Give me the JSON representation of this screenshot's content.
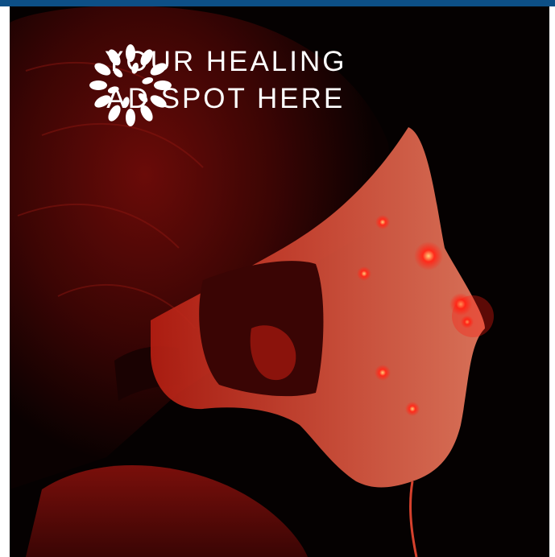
{
  "ad": {
    "headline_line1": "YOUR HEALING",
    "headline_line2": "AD SPOT HERE",
    "logo_icon": "leaf-burst-logo-icon",
    "photo_subject": "person-wearing-red-led-face-mask",
    "colors": {
      "top_bar": "#0d4f86",
      "text": "#ffffff",
      "led_red": "#ff2a1a"
    }
  }
}
